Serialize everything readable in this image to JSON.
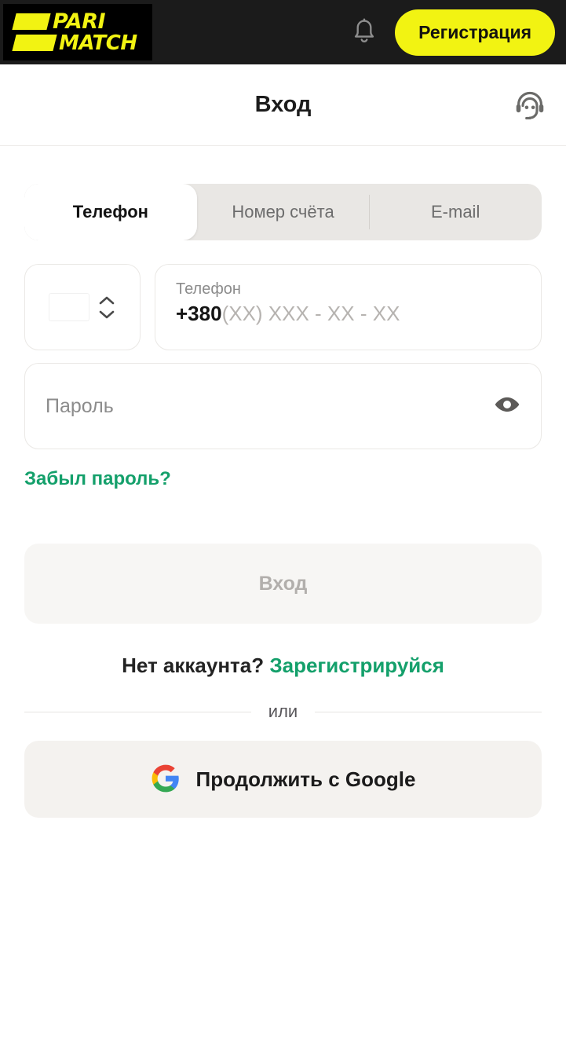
{
  "topbar": {
    "logo": {
      "line1": "PARI",
      "line2": "MATCH",
      "icon_name": "parimatch-logo"
    },
    "notifications_icon": "bell-icon",
    "register_label": "Регистрация",
    "colors": {
      "background": "#1b1b1b",
      "brand_yellow": "#f2f312",
      "logo_background": "#000000"
    }
  },
  "header": {
    "title": "Вход",
    "support_icon": "support-headset-icon"
  },
  "tabs": [
    {
      "label": "Телефон",
      "active": true
    },
    {
      "label": "Номер счёта",
      "active": false
    },
    {
      "label": "E-mail",
      "active": false
    }
  ],
  "form": {
    "country": {
      "flag_icon": "ukraine-flag-icon",
      "selector_icon": "chevron-up-down-icon",
      "flag_colors": {
        "top": "#2d74cd",
        "bottom": "#ffd84d"
      }
    },
    "phone": {
      "label": "Телефон",
      "prefix": "+380",
      "mask": "(XX) XXX - XX - XX"
    },
    "password": {
      "placeholder": "Пароль",
      "toggle_icon": "eye-icon"
    },
    "forgot_password": "Забыл пароль?",
    "submit_label": "Вход",
    "submit_disabled": true
  },
  "footer": {
    "signup_prompt": "Нет аккаунта?",
    "signup_link": "Зарегистрируйся",
    "or_text": "или",
    "google": {
      "label": "Продолжить с Google",
      "icon": "google-g-icon"
    }
  },
  "colors": {
    "accent_green": "#14a06b",
    "text_dark": "#1c1c1c",
    "muted": "#8c8c8c",
    "surface": "#f4f2ef"
  }
}
